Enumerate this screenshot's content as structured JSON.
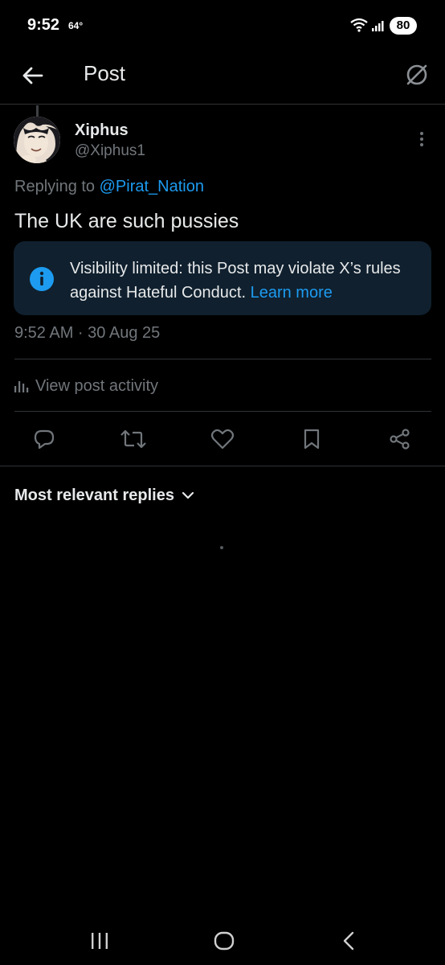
{
  "status_bar": {
    "time": "9:52",
    "temperature": "64°",
    "battery": "80"
  },
  "header": {
    "title": "Post",
    "back_icon": "arrow-left-icon",
    "grok_icon": "grok-icon"
  },
  "post": {
    "display_name": "Xiphus",
    "handle": "@Xiphus1",
    "replying_prefix": "Replying to",
    "replying_to": "@Pirat_Nation",
    "text": "The UK are such pussies",
    "notice": {
      "text": "Visibility limited: this Post may violate X’s rules against Hateful Conduct.",
      "link": "Learn more"
    },
    "timestamp": "9:52 AM · 30 Aug 25",
    "view_activity": "View post activity"
  },
  "actions": [
    "reply-icon",
    "repost-icon",
    "like-icon",
    "bookmark-icon",
    "share-icon"
  ],
  "replies": {
    "sort_label": "Most relevant replies"
  },
  "colors": {
    "background": "#000000",
    "accent": "#1d9bf0",
    "secondary_text": "#71767b",
    "notice_bg": "#10202e",
    "divider": "#2f3336"
  }
}
